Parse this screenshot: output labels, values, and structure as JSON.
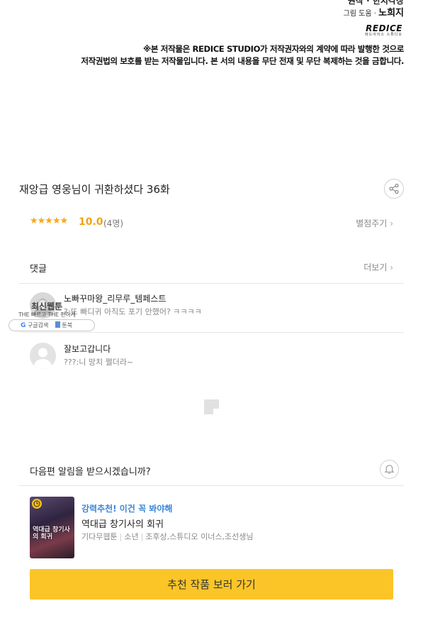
{
  "credits": {
    "line1": "원작 · 한치각장",
    "line2_role": "그림 도움 · ",
    "line2_name": "노희지",
    "studio_logo": "REDICE",
    "studio_logo_sub": "레드아이스 스튜디오",
    "copyright_line1": "※본 저작물은 REDICE STUDIO가 저작권자와의 계약에 따라 발행한 것으로",
    "copyright_line2": "저작권법의 보호를 받는 저작물입니다. 본 서의 내용을 무단 전재 및 무단 복제하는 것을 금합니다."
  },
  "episode": {
    "title": "재앙급 영웅님이 귀환하셨다 36화"
  },
  "rating": {
    "stars": 5,
    "score": "10.0",
    "count": "(4명)",
    "rate_link": "별점주기"
  },
  "comments": {
    "header": "댓글",
    "more": "더보기",
    "items": [
      {
        "author": "노빠꾸마왕_리무루_템페스트",
        "body": "?:또 빠디귀 아직도 포기 안했어? ㅋㅋㅋㅋ"
      },
      {
        "author": "잘보고갑니다",
        "body": "???:니 망치 쩔더라~"
      }
    ]
  },
  "watermark": {
    "title": "최신웹툰",
    "tagline": "THE 빠르고 THE 편하게",
    "search_label": "구글검색",
    "brand": "툰북"
  },
  "notify": {
    "text": "다음편 알림을 받으시겠습니까?"
  },
  "recommendation": {
    "tag": "강력추천! 이건 꼭 봐야해",
    "title": "역대급 창기사의 회귀",
    "genre": "기다무웹툰",
    "category": "소년",
    "authors": "조후상,스튜디오 이너스,조선생님",
    "thumb_text": "역대급 창기사의 회귀",
    "cta": "추천 작품 보러 가기"
  },
  "colors": {
    "accent_yellow": "#fbc527",
    "star_orange": "#f6a91b",
    "link_blue": "#3a86d8"
  }
}
